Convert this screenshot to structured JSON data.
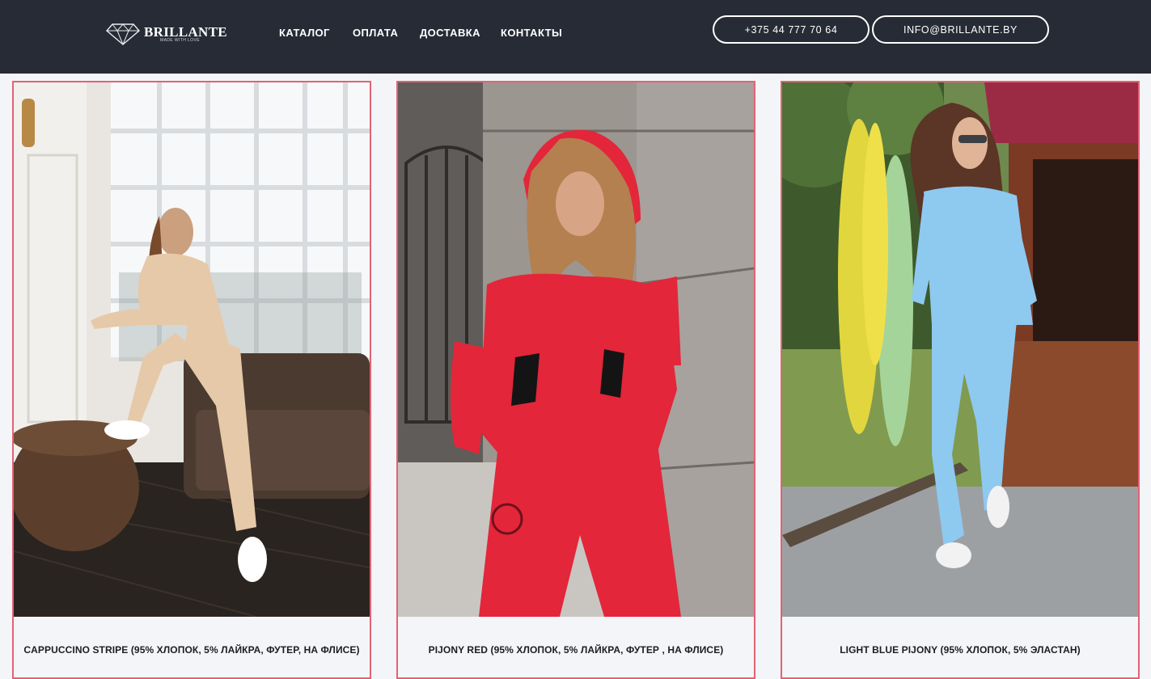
{
  "header": {
    "logo": {
      "name": "BRILLANTE",
      "tagline": "MADE WITH LOVE",
      "icon": "diamond-icon"
    },
    "nav": [
      {
        "label": "КАТАЛОГ"
      },
      {
        "label": "ОПЛАТА"
      },
      {
        "label": "ДОСТАВКА"
      },
      {
        "label": "КОНТАКТЫ"
      }
    ],
    "phone": "+375 44 777 70 64",
    "email": "INFO@BRILLANTE.BY"
  },
  "products": [
    {
      "title": "CAPPUCCINO STRIPE (95% ХЛОПОК, 5% ЛАЙКРА, ФУТЕР, НА ФЛИСЕ)",
      "suit_color": "#e6c9a8"
    },
    {
      "title": "PIJONY RED (95% ХЛОПОК, 5% ЛАЙКРА, ФУТЕР , НА ФЛИСЕ)",
      "suit_color": "#e3263a"
    },
    {
      "title": "LIGHT BLUE PIJONY (95% ХЛОПОК, 5% ЭЛАСТАН)",
      "suit_color": "#8ec9f0"
    }
  ],
  "colors": {
    "header_bg": "#262b35",
    "card_border": "#e56174",
    "page_bg": "#f4f5f8"
  }
}
